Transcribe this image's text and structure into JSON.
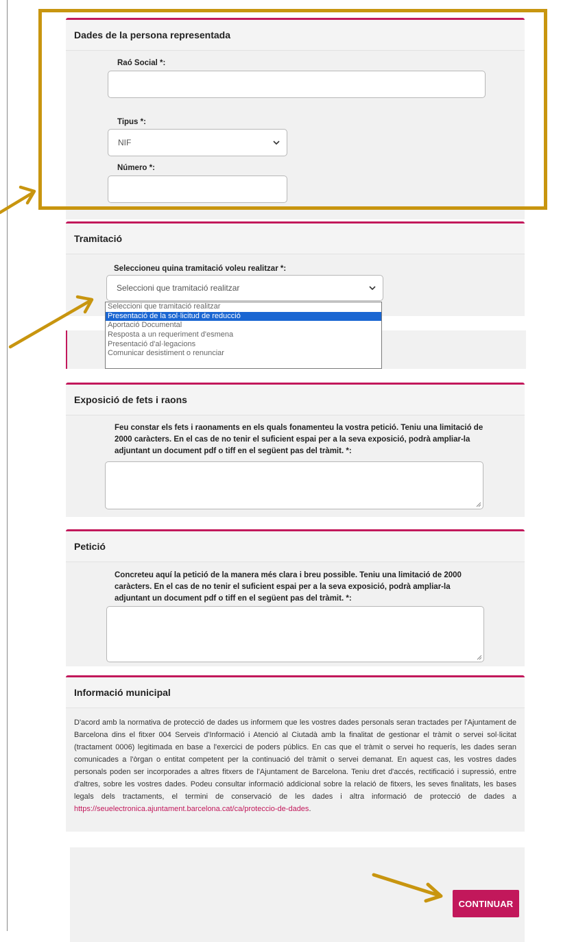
{
  "persona": {
    "title": "Dades de la persona representada",
    "rao_social_label": "Raó Social *:",
    "rao_social_value": "",
    "tipus_label": "Tipus *:",
    "tipus_value": "NIF",
    "numero_label": "Número *:",
    "numero_value": ""
  },
  "tramitacio": {
    "title": "Tramitació",
    "select_label": "Seleccioneu quina tramitació voleu realitzar *:",
    "select_value": "Seleccioni que tramitació realitzar",
    "options": [
      "Seleccioni que tramitació realitzar",
      "Presentació de la sol·licitud de reducció",
      "Aportació Documental",
      "Resposta a un requeriment d'esmena",
      "Presentació d'al·legacions",
      "Comunicar desistiment o renunciar"
    ],
    "highlighted_option": "Presentació de la sol·licitud de reducció"
  },
  "exposicio": {
    "title": "Exposició de fets i raons",
    "label": "Feu constar els fets i raonaments en els quals fonamenteu la vostra petició. Teniu una limitació de 2000 caràcters. En el cas de no tenir el suficient espai per a la seva exposició, podrà ampliar-la adjuntant un document pdf o tiff en el següent pas del tràmit. *:",
    "value": ""
  },
  "peticio": {
    "title": "Petició",
    "label": "Concreteu aquí la petició de la manera més clara i breu possible. Teniu una limitació de 2000 caràcters. En el cas de no tenir el suficient espai per a la seva exposició, podrà ampliar-la adjuntant un document pdf o tiff en el següent pas del tràmit. *:",
    "value": ""
  },
  "informacio": {
    "title": "Informació municipal",
    "text": "D'acord amb la normativa de protecció de dades us informem que les vostres dades personals seran tractades per l'Ajuntament de Barcelona dins el fitxer 004 Serveis d'Informació i Atenció al Ciutadà amb la finalitat de gestionar el tràmit o servei sol·licitat (tractament 0006) legitimada en base a l'exercici de poders públics. En cas que el tràmit o servei ho requerís, les dades seran comunicades a l'òrgan o entitat competent per la continuació del tràmit o servei demanat. En aquest cas, les vostres dades personals poden ser incorporades a altres fitxers de l'Ajuntament de Barcelona. Teniu dret d'accés, rectificació i supressió, entre d'altres, sobre les vostres dades. Podeu consultar informació addicional sobre la relació de fitxers, les seves finalitats, les bases legals dels tractaments, el termini de conservació de les dades i altra informació de protecció de dades a ",
    "link": "https://seuelectronica.ajuntament.barcelona.cat/ca/proteccio-de-dades",
    "suffix": "."
  },
  "continue_label": "CONTINUAR",
  "colors": {
    "accent": "#c2185b",
    "highlight": "#c8950f",
    "selected_option": "#1a66d2"
  }
}
